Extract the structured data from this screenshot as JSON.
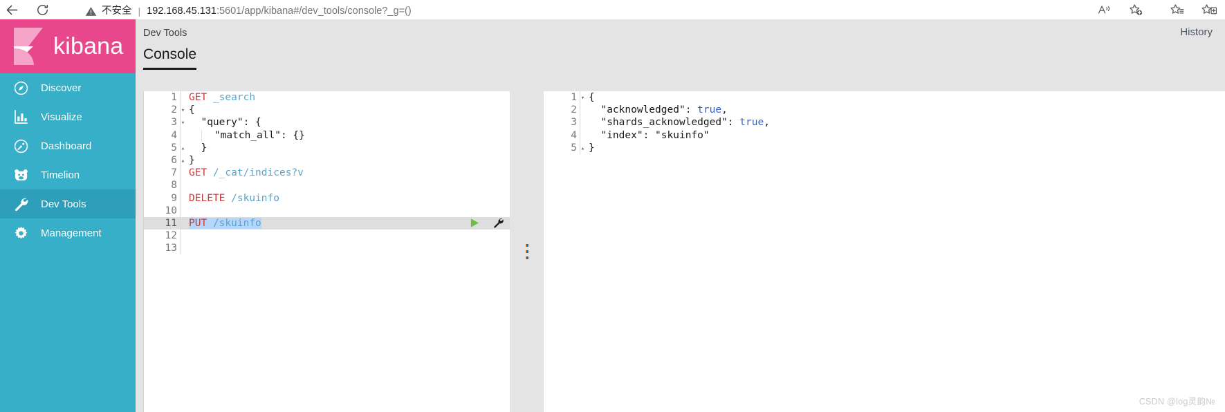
{
  "browser": {
    "back_icon": "arrow-left-icon",
    "reload_icon": "reload-icon",
    "security_label": "不安全",
    "separator": "|",
    "url_host": "192.168.45.131",
    "url_rest": ":5601/app/kibana#/dev_tools/console?_g=()",
    "url_full": "192.168.45.131:5601/app/kibana#/dev_tools/console?_g=()",
    "actions": [
      {
        "name": "read-aloud-icon",
        "glyph": "A"
      },
      {
        "name": "add-favorite-icon",
        "glyph": "star-plus"
      },
      {
        "name": "favorites-icon",
        "glyph": "star-list"
      },
      {
        "name": "collections-icon",
        "glyph": "collections"
      }
    ]
  },
  "sidebar": {
    "brand": "kibana",
    "brand_color": "#E8488B",
    "nav_color": "#37AFC9",
    "active_color": "#2E9FBB",
    "items": [
      {
        "label": "Discover",
        "icon": "compass-icon",
        "active": false
      },
      {
        "label": "Visualize",
        "icon": "bar-chart-icon",
        "active": false
      },
      {
        "label": "Dashboard",
        "icon": "gauge-icon",
        "active": false
      },
      {
        "label": "Timelion",
        "icon": "bear-icon",
        "active": false
      },
      {
        "label": "Dev Tools",
        "icon": "wrench-icon",
        "active": true
      },
      {
        "label": "Management",
        "icon": "gear-icon",
        "active": false
      }
    ]
  },
  "header": {
    "breadcrumb": "Dev Tools",
    "history_label": "History",
    "tab_label": "Console"
  },
  "editor": {
    "lines": [
      {
        "n": "1",
        "fold": "",
        "text": "GET _search"
      },
      {
        "n": "2",
        "fold": "▾",
        "text": "{"
      },
      {
        "n": "3",
        "fold": "▾",
        "text": "  \"query\": {"
      },
      {
        "n": "4",
        "fold": "",
        "text": "    \"match_all\": {}"
      },
      {
        "n": "5",
        "fold": "▴",
        "text": "  }"
      },
      {
        "n": "6",
        "fold": "▴",
        "text": "}"
      },
      {
        "n": "7",
        "fold": "",
        "text": "GET /_cat/indices?v"
      },
      {
        "n": "8",
        "fold": "",
        "text": ""
      },
      {
        "n": "9",
        "fold": "",
        "text": "DELETE /skuinfo"
      },
      {
        "n": "10",
        "fold": "",
        "text": ""
      },
      {
        "n": "11",
        "fold": "",
        "text": "PUT /skuinfo"
      },
      {
        "n": "12",
        "fold": "",
        "text": ""
      },
      {
        "n": "13",
        "fold": "",
        "text": ""
      }
    ],
    "active_line": "11",
    "play_icon": "play-triangle-icon",
    "wrench_icon": "wrench-settings-icon",
    "play_color": "#6CBE45"
  },
  "response": {
    "lines": [
      {
        "n": "1",
        "fold": "▾",
        "text": "{"
      },
      {
        "n": "2",
        "fold": "",
        "text": "  \"acknowledged\": true,"
      },
      {
        "n": "3",
        "fold": "",
        "text": "  \"shards_acknowledged\": true,"
      },
      {
        "n": "4",
        "fold": "",
        "text": "  \"index\": \"skuinfo\""
      },
      {
        "n": "5",
        "fold": "▴",
        "text": "}"
      }
    ]
  },
  "splitter": {
    "name": "pane-drag-handle"
  },
  "watermark": "CSDN @log灵韵№"
}
